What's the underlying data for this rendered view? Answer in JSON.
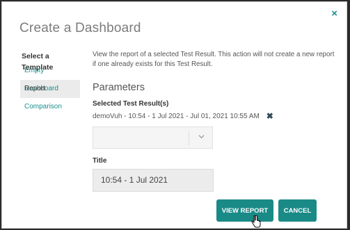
{
  "dialog": {
    "title": "Create a Dashboard",
    "close_label": "×"
  },
  "sidebar": {
    "heading": "Select a Template",
    "items": [
      {
        "label": "Empty Dashboard",
        "active": false
      },
      {
        "label": "Report",
        "active": true
      },
      {
        "label": "Comparison",
        "active": false
      }
    ]
  },
  "content": {
    "description": "View the report of a selected Test Result. This action will not create a new report if one already exists for this Test Result.",
    "parameters_heading": "Parameters",
    "selected_label": "Selected Test Result(s)",
    "selected_value": "demoVuh - 10:54 - 1 Jul 2021 - Jul 01, 2021 10:55 AM",
    "remove_icon": "x-icon",
    "dropdown_chevron": "chevron-down-icon",
    "title_label": "Title",
    "title_value": "10:54 - 1 Jul 2021"
  },
  "buttons": {
    "view_report": "VIEW REPORT",
    "cancel": "CANCEL"
  },
  "colors": {
    "accent": "#1a8a87",
    "link": "#1a8f8c"
  }
}
